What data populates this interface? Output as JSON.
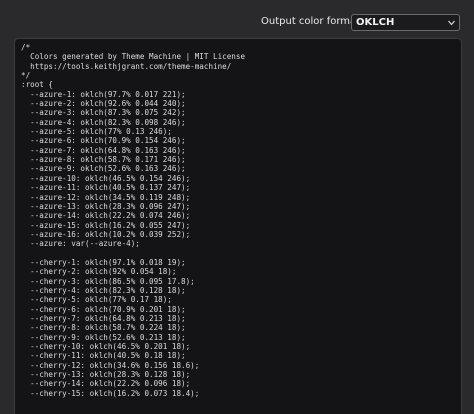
{
  "header": {
    "format_label": "Output color format",
    "format_value": "OKLCH",
    "caret_icon": "chevron-down-icon"
  },
  "code": {
    "lines": [
      "/*",
      "  Colors generated by Theme Machine | MIT License",
      "  https://tools.keithjgrant.com/theme-machine/",
      "*/",
      ":root {",
      "  --azure-1: oklch(97.7% 0.017 221);",
      "  --azure-2: oklch(92.6% 0.044 240);",
      "  --azure-3: oklch(87.3% 0.075 242);",
      "  --azure-4: oklch(82.3% 0.098 246);",
      "  --azure-5: oklch(77% 0.13 246);",
      "  --azure-6: oklch(70.9% 0.154 246);",
      "  --azure-7: oklch(64.8% 0.163 246);",
      "  --azure-8: oklch(58.7% 0.171 246);",
      "  --azure-9: oklch(52.6% 0.163 246);",
      "  --azure-10: oklch(46.5% 0.154 246);",
      "  --azure-11: oklch(40.5% 0.137 247);",
      "  --azure-12: oklch(34.5% 0.119 248);",
      "  --azure-13: oklch(28.3% 0.096 247);",
      "  --azure-14: oklch(22.2% 0.074 246);",
      "  --azure-15: oklch(16.2% 0.055 247);",
      "  --azure-16: oklch(10.2% 0.039 252);",
      "  --azure: var(--azure-4);",
      "",
      "  --cherry-1: oklch(97.1% 0.018 19);",
      "  --cherry-2: oklch(92% 0.054 18);",
      "  --cherry-3: oklch(86.5% 0.095 17.8);",
      "  --cherry-4: oklch(82.3% 0.128 18);",
      "  --cherry-5: oklch(77% 0.17 18);",
      "  --cherry-6: oklch(70.9% 0.201 18);",
      "  --cherry-7: oklch(64.8% 0.213 18);",
      "  --cherry-8: oklch(58.7% 0.224 18);",
      "  --cherry-9: oklch(52.6% 0.213 18);",
      "  --cherry-10: oklch(46.5% 0.201 18);",
      "  --cherry-11: oklch(40.5% 0.18 18);",
      "  --cherry-12: oklch(34.6% 0.156 18.6);",
      "  --cherry-13: oklch(28.3% 0.128 18);",
      "  --cherry-14: oklch(22.2% 0.096 18);",
      "  --cherry-15: oklch(16.2% 0.073 18.4);"
    ]
  }
}
